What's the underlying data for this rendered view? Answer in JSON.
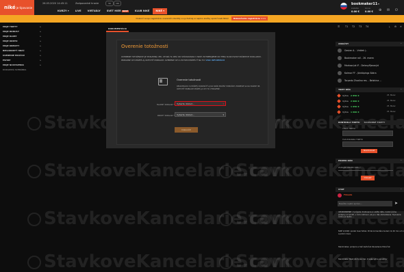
{
  "header": {
    "logo_main": "niké",
    "logo_sub": "je tipovanie",
    "datetime": "26.03.2020 14:45:11",
    "responsible": "Zodpovedné hranie",
    "lang1": "SK",
    "lang2": "ON",
    "nav": [
      {
        "label": "KURZY",
        "chevron": true
      },
      {
        "label": "LIVE"
      },
      {
        "label": "VIRTUÁLY"
      },
      {
        "label": "SVET HIER",
        "badge": "NOVÉ"
      },
      {
        "label": "KLUB NIKÉ"
      },
      {
        "label": "NIKÉ",
        "chevron": true,
        "active": true
      }
    ],
    "user": {
      "name": "bookmaker11",
      "balance_label": "zostatok",
      "balance": "0.00 €",
      "bonus_label": "bonus",
      "bonus": "0.00 €"
    }
  },
  "notice": {
    "text": "Dokonči svoju registráciu overením identity a vychutnaj si naplno služby spoločnosti Niké!",
    "button": "Dokončenie registrácie >>>"
  },
  "sidebar": {
    "items": [
      {
        "label": "MOJE TIKETY",
        "chevron": true
      },
      {
        "label": "MOJE BONUSY",
        "chevron": true
      },
      {
        "label": "MOJE KLUBY",
        "chevron": true
      },
      {
        "label": "MOJE KONTO",
        "chevron": true
      },
      {
        "label": "MOJE KREDITY",
        "chevron": true
      },
      {
        "label": "BIELOKONTÝ HRÁČ",
        "chevron": true
      },
      {
        "label": "OVERENIE HRÁČOV",
        "chevron": true
      },
      {
        "label": "ESHOP",
        "chevron": true
      },
      {
        "label": "MOJE NASTAVENIA",
        "chevron": true
      },
      {
        "label": "DOKAZOVÁ SCHRÁNKA",
        "chevron": false
      }
    ]
  },
  "watermark": "StavkoveKancelarie.com",
  "main": {
    "tab": "DOKUMENTÁCIA",
    "modal": {
      "title": "Overenie totožnosti",
      "intro": "OVERENIE TOTOŽNOSTI JE POSLEDNÁ VEC, KTORÁ TA DELÍ OD STÁVKOVANIA V NIKÉ. POTREBUJEME OD TEBA SCAN DVOCH RÔZNYCH DOKLADOV. PRIPADNE ICH MÔŽEŠ AJ ODFOTIŤ MOBILOM. OVERENIE ICH A POTOM MÔŽEŠ IŤ NA TO!",
      "intro_link": "VIAC INFORMÁCIÍ",
      "doc_title": "Overenie totožnosti",
      "doc_text": "REGISTRÁCIU SI MÔŽEŠ DOKONČIŤ AJ NA SKÔR MOŽNÝ POBOČKE, PRINESIE SA NA BLÍZKE 3B. ODFOTIŤ MOBILOM MÔŽEŠ JA ICH TO VYBAVENÉ.",
      "primary_label": "HLAVNÝ DOKLAD *",
      "primary_placeholder": "Vyberte doklad...",
      "secondary_label": "DRUHÝ DOKLAD *",
      "secondary_placeholder": "Vyberte doklad...",
      "submit": "Dokončiť"
    }
  },
  "right": {
    "tabs": [
      "T1",
      "T2",
      "T3",
      "T4"
    ],
    "analysis_title": "ANALÝZY",
    "analysis": [
      "Gavian A. - Vrátek j..",
      "Bookmaker roll - 26. marec",
      "Markazrjuk IF - Delanyffjanarýd",
      "Kalmar FF - Jönköpings Södra",
      "Torpedo Zhodino res. - Belshina ..."
    ],
    "tiket_title": "TIKET DŇA",
    "tikets": [
      {
        "name": "Výhra",
        "value": "2 850 €",
        "time": "25. Marec"
      },
      {
        "name": "Výhra",
        "value": "2 000 €",
        "time": "25. Marec"
      },
      {
        "name": "Výhra",
        "value": "1 950 €",
        "time": "25. Marec"
      },
      {
        "name": "Výhra",
        "value": "1 600 €",
        "time": "25. Marec"
      }
    ],
    "kontrola_title": "KONTROLA TIKETU",
    "kontrola_tab2": "SLUŽOBNÉ TIKETY",
    "ticket_number_label": "ČÍSLO TIKETU",
    "ticket_time_label": "ČAS PODANIA TIKETU",
    "check_button": "Skontrolovať",
    "promo_title": "PROMO KÓD",
    "promo_placeholder": "ZADAJTE PROMO KÓD *",
    "promo_button": "Odoslať",
    "chat_title": "CHAT",
    "chat_user": "Filmolis",
    "chat_placeholder": "Napíšte nejakú správu...",
    "chat_messages": [
      "UPOZORNENIE: V prípade chatovania si uložte dáta, riadok počas podpory od 14:20, v čom rozhovor, ak je u Vás obmedzenie. Tipovanie online je lepšie ...",
      "NIKÉ 4/1000: predal mesi futbal. Pridal komentáre budem do 40 min a 6 x a potom dáva.",
      "Stackmates: podpora a tiež zaútočeli Zaviedenie Pobočnik",
      "Stackmate: 'Nakryté ho sa mal. O vaše výhre sa výhra'"
    ]
  }
}
